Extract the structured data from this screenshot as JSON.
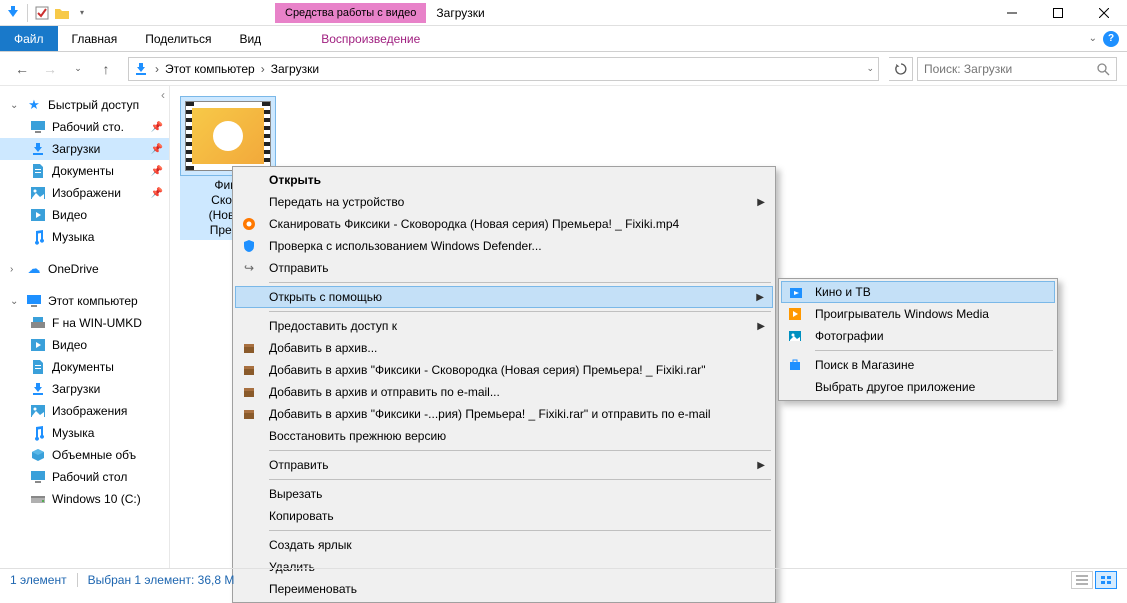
{
  "window": {
    "title": "Загрузки",
    "contextual_tab": "Средства работы с видео"
  },
  "ribbon": {
    "file": "Файл",
    "tabs": [
      "Главная",
      "Поделиться",
      "Вид"
    ],
    "context_tab": "Воспроизведение"
  },
  "breadcrumb": {
    "segments": [
      "Этот компьютер",
      "Загрузки"
    ]
  },
  "search": {
    "placeholder": "Поиск: Загрузки"
  },
  "sidebar": {
    "quick_access": "Быстрый доступ",
    "items_qa": [
      {
        "label": "Рабочий сто.",
        "icon": "desktop",
        "pin": true
      },
      {
        "label": "Загрузки",
        "icon": "download",
        "pin": true,
        "selected": true
      },
      {
        "label": "Документы",
        "icon": "documents",
        "pin": true
      },
      {
        "label": "Изображени",
        "icon": "pictures",
        "pin": true
      },
      {
        "label": "Видео",
        "icon": "videos",
        "pin": false
      },
      {
        "label": "Музыка",
        "icon": "music",
        "pin": false
      }
    ],
    "onedrive": "OneDrive",
    "this_pc": "Этот компьютер",
    "items_pc": [
      {
        "label": "F на WIN-UMKD",
        "icon": "netdrive"
      },
      {
        "label": "Видео",
        "icon": "videos"
      },
      {
        "label": "Документы",
        "icon": "documents"
      },
      {
        "label": "Загрузки",
        "icon": "download"
      },
      {
        "label": "Изображения",
        "icon": "pictures"
      },
      {
        "label": "Музыка",
        "icon": "music"
      },
      {
        "label": "Объемные объ",
        "icon": "3d"
      },
      {
        "label": "Рабочий стол",
        "icon": "desktop"
      },
      {
        "label": "Windows 10 (C:)",
        "icon": "drive"
      }
    ]
  },
  "file": {
    "name_lines": [
      "Фикс",
      "Сково",
      "(Новая",
      "Премь"
    ]
  },
  "context_menu": {
    "open": "Открыть",
    "cast": "Передать на устройство",
    "scan_avast": "Сканировать Фиксики - Сковородка (Новая серия) Премьера! _ Fixiki.mp4",
    "defender": "Проверка с использованием Windows Defender...",
    "send": "Отправить",
    "open_with": "Открыть с помощью",
    "share_access": "Предоставить доступ к",
    "add_archive": "Добавить в архив...",
    "add_rar": "Добавить в архив \"Фиксики - Сковородка (Новая серия) Премьера! _ Fixiki.rar\"",
    "add_email": "Добавить в архив и отправить по e-mail...",
    "add_rar_email": "Добавить в архив \"Фиксики -...рия) Премьера! _ Fixiki.rar\" и отправить по e-mail",
    "restore": "Восстановить прежнюю версию",
    "send_to": "Отправить",
    "cut": "Вырезать",
    "copy": "Копировать",
    "shortcut": "Создать ярлык",
    "delete": "Удалить",
    "rename": "Переименовать"
  },
  "submenu": {
    "movies_tv": "Кино и ТВ",
    "wmp": "Проигрыватель Windows Media",
    "photos": "Фотографии",
    "store": "Поиск в Магазине",
    "choose": "Выбрать другое приложение"
  },
  "status": {
    "count": "1 элемент",
    "selection": "Выбран 1 элемент: 36,8 М"
  }
}
